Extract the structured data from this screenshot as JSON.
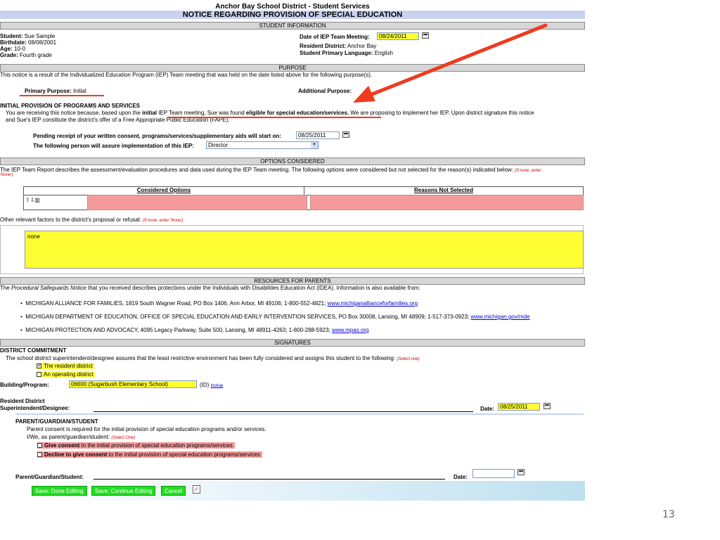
{
  "header": {
    "district_title": "Anchor Bay School District - Student Services",
    "notice_title": "NOTICE REGARDING PROVISION OF SPECIAL EDUCATION"
  },
  "student_info": {
    "section": "STUDENT INFORMATION",
    "student_label": "Student:",
    "student_value": "Sue Sample",
    "birthdate_label": "Birthdate:",
    "birthdate_value": "08/08/2001",
    "age_label": "Age:",
    "age_value": "10-0",
    "grade_label": "Grade:",
    "grade_value": "Fourth grade",
    "meeting_date_label": "Date of IEP Team Meeting:",
    "meeting_date_value": "08/24/2011",
    "resident_district_label": "Resident District:",
    "resident_district_value": "Anchor Bay",
    "language_label": "Student Primary Language:",
    "language_value": "English"
  },
  "purpose": {
    "section": "PURPOSE",
    "intro": "This notice is a result of the Individualized Education Program (IEP) Team meeting that was held on the date listed above for the following purpose(s).",
    "primary_label": "Primary Purpose:",
    "primary_value": "Initial",
    "additional_label": "Additional Purpose:",
    "initial_heading": "INITIAL PROVISION OF PROGRAMS AND SERVICES",
    "initial_text_1": "You are receiving this notice because, based upon the",
    "initial_bold_1": "initial",
    "initial_text_2": "IEP Team meeting, Sue was found",
    "initial_bold_2": "eligible for special education/services.",
    "initial_text_3": "We are proposing to implement her IEP. Upon district signature this notice",
    "initial_text_4": "and Sue's IEP constitute the district's offer of a Free Appropriate Public Education (FAPE).",
    "pending_label": "Pending receipt of your written consent, programs/services/supplementary aids will start on:",
    "pending_date": "08/25/2011",
    "assure_label": "The following person will assure implementation of this IEP:",
    "assure_value": "Director"
  },
  "options": {
    "section": "OPTIONS CONSIDERED",
    "intro": "The IEP Team Report describes the assessment/evaluation procedures and data used during the IEP Team meeting. The following options were considered but not selected for the reason(s) indicated below:",
    "intro_hint_1": "(If none, enter",
    "intro_hint_2": "'None')",
    "col_considered": "Considered Options",
    "col_reasons": "Reasons Not Selected",
    "other_label": "Other relevant factors to the district's proposal or refusal:",
    "other_hint": "(If none, enter 'None')",
    "other_value": "none"
  },
  "resources": {
    "section": "RESOURCES FOR PARENTS",
    "intro_1": "The",
    "intro_italic": "Procedural Safeguards Notice",
    "intro_2": "that you received describes protections under the Individuals with Disabilities Education Act (IDEA). Information is also available from:",
    "items": [
      {
        "text": "MICHIGAN ALLIANCE FOR FAMILIES, 1819 South Wagner Road, PO Box 1406, Ann Arbor, MI 49106; 1-800-552-4821;",
        "link": "www.michiganallianceforfamilies.org"
      },
      {
        "text": "MICHIGAN DEPARTMENT OF EDUCATION, OFFICE OF SPECIAL EDUCATION AND EARLY INTERVENTION SERVICES, PO Box 30008, Lansing, MI 48909; 1-517-373-0923;",
        "link": "www.michigan.gov/mde"
      },
      {
        "text": "MICHIGAN PROTECTION AND ADVOCACY, 4095 Legacy Parkway, Suite 500, Lansing, MI 48911-4263; 1-800-288-5923;",
        "link": "www.mpas.org"
      }
    ]
  },
  "signatures": {
    "section": "SIGNATURES",
    "district_heading": "DISTRICT COMMITMENT",
    "district_text": "The school district superintendent/designee assures that the least restrictive environment has been fully considered and assigns this student to the following:",
    "select_one": "(Select one)",
    "opt_resident": "The resident district",
    "opt_operating": "An operating district",
    "building_label": "Building/Program:",
    "building_value": "06600 (Sugarbush Elementary School)",
    "id_label": "(ID)",
    "lookup_label": "lookup",
    "resident_label_1": "Resident District",
    "resident_label_2": "Superintendent/Designee:",
    "date_label": "Date:",
    "district_date": "08/25/2011",
    "parent_heading": "PARENT/GUARDIAN/STUDENT",
    "parent_text": "Parent consent is required for the initial provision of special education programs and/or services.",
    "parent_as": "I/We, as parent/guardian/student:",
    "parent_select": "(Select One)",
    "give_bold": "Give consent",
    "give_rest": "to the initial provision of special education programs/services",
    "decline_bold": "Decline to give consent",
    "decline_rest": "to the initial provision of special education programs/services",
    "parent_sig_label": "Parent/Guardian/Student:",
    "parent_date_label": "Date:",
    "parent_date_value": ""
  },
  "buttons": {
    "save_done": "Save: Done Editing",
    "save_continue": "Save: Continue Editing",
    "cancel": "Cancel"
  },
  "slide": {
    "page_number": "13"
  },
  "colors": {
    "annotation_red": "#ee3b1f",
    "highlight_yellow": "#ffff44",
    "button_green": "#22dd22",
    "pink_field": "#f59a9a"
  }
}
